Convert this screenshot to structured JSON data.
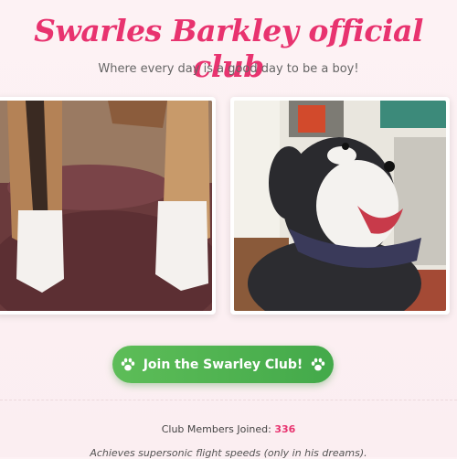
{
  "header": {
    "title": "Swarles Barkley official club",
    "subtitle": "Where every day is a good day to be a boy!"
  },
  "gallery": {
    "photos": [
      {
        "subject": "dog paws resting on a burgundy cushion"
      },
      {
        "subject": "smiling black and white dog wearing a bandana"
      }
    ]
  },
  "cta": {
    "label": "Join the Swarley Club!",
    "icon": "paw-icon",
    "color": "#4caf50"
  },
  "stats": {
    "members_label": "Club Members Joined:",
    "members_count": "336"
  },
  "footer": {
    "tagline": "Achieves supersonic flight speeds (only in his dreams)."
  },
  "theme": {
    "accent": "#e8336f",
    "background": "#fdf2f4"
  }
}
